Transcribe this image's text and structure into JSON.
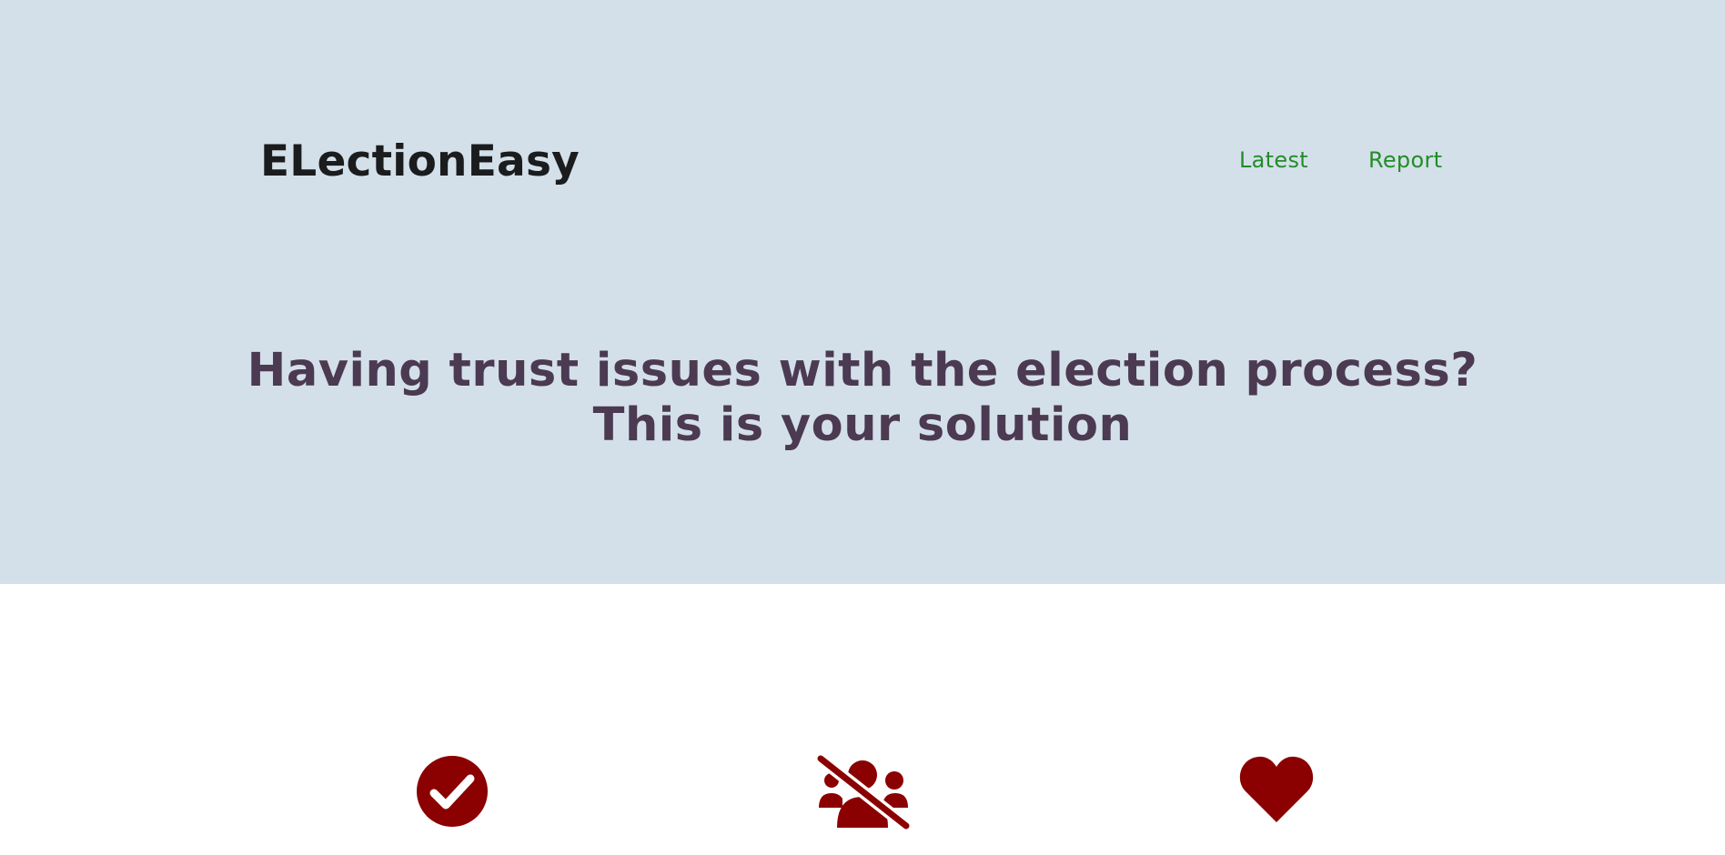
{
  "header": {
    "brand": "ELectionEasy",
    "nav": [
      "Latest",
      "Report"
    ]
  },
  "hero": {
    "headline_line1": "Having trust issues with the election process?",
    "headline_line2": "This is your solution"
  },
  "features": [
    {
      "icon": "check-circle-icon"
    },
    {
      "icon": "users-slash-icon"
    },
    {
      "icon": "heart-icon"
    }
  ],
  "colors": {
    "hero_bg": "#d4e0e9",
    "brand": "#1b1c1e",
    "nav_link": "#238c2a",
    "headline": "#4b3a51",
    "icon": "#8b0000"
  }
}
